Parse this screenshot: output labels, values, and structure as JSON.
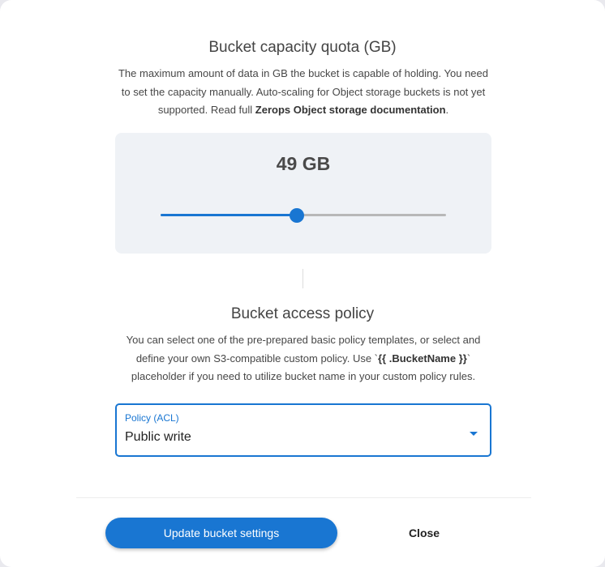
{
  "quota": {
    "title": "Bucket capacity quota (GB)",
    "description_part1": "The maximum amount of data in GB the bucket is capable of holding. You need to set the capacity manually. Auto-scaling for Object storage buckets is not yet supported. Read full ",
    "description_link": "Zerops Object storage documentation",
    "description_part2": ".",
    "value_display": "49 GB",
    "slider_fraction": 0.478
  },
  "policy": {
    "title": "Bucket access policy",
    "description_part1": "You can select one of the pre-prepared basic policy templates, or select and define your own S3-compatible custom policy. Use `",
    "description_code": "{{ .BucketName }}",
    "description_part2": "` placeholder if you need to utilize bucket name in your custom policy rules.",
    "select_label": "Policy (ACL)",
    "select_value": "Public write"
  },
  "actions": {
    "update_label": "Update bucket settings",
    "close_label": "Close"
  },
  "colors": {
    "accent": "#1976d2",
    "box_bg": "#eff2f6"
  }
}
